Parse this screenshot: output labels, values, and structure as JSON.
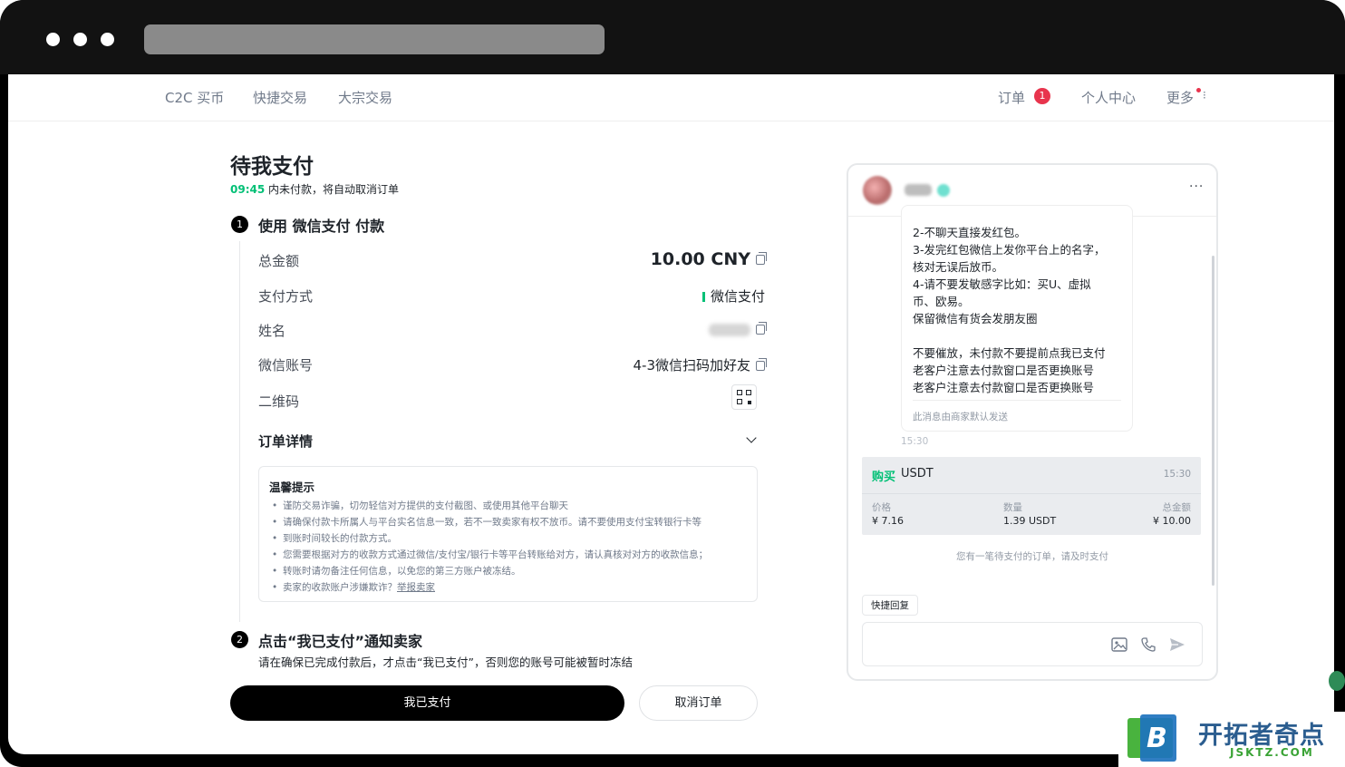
{
  "browser": {
    "dots": 3
  },
  "nav": {
    "left": [
      "C2C 买币",
      "快捷交易",
      "大宗交易"
    ],
    "orders_label": "订单",
    "orders_badge": "1",
    "profile_label": "个人中心",
    "more_label": "更多"
  },
  "main": {
    "title": "待我支付",
    "timer": "09:45",
    "timer_suffix": " 内未付款，将自动取消订单",
    "step1": {
      "num": "1",
      "title": "使用 微信支付 付款"
    },
    "rows": {
      "amount_label": "总金额",
      "amount_value": "10.00 CNY",
      "method_label": "支付方式",
      "method_value": "微信支付",
      "name_label": "姓名",
      "account_label": "微信账号",
      "account_value": "4-3微信扫码加好友",
      "qr_label": "二维码"
    },
    "details_label": "订单详情",
    "tips": {
      "title": "温馨提示",
      "items": [
        "谨防交易诈骗，切勿轻信对方提供的支付截图、或使用其他平台聊天",
        "请确保付款卡所属人与平台实名信息一致，若不一致卖家有权不放币。请不要使用支付宝转银行卡等",
        "到账时间较长的付款方式。",
        "您需要根据对方的收款方式通过微信/支付宝/银行卡等平台转账给对方，请认真核对对方的收款信息；",
        "转账时请勿备注任何信息，以免您的第三方账户被冻结。"
      ],
      "last_prefix": "卖家的收款账户涉嫌欺诈？",
      "report_link": "举报卖家"
    },
    "step2": {
      "num": "2",
      "title": "点击“我已支付”通知卖家"
    },
    "step2_note": "请在确保已完成付款后，才点击“我已支付”，否则您的账号可能被暂时冻结",
    "paid_button": "我已支付",
    "cancel_button": "取消订单"
  },
  "chat": {
    "more": "···",
    "message_lines": [
      "2-不聊天直接发红包。",
      "3-发完红包微信上发你平台上的名字，",
      "核对无误后放币。",
      "4-请不要发敏感字比如：买U、虚拟",
      "币、欧易。",
      "保留微信有货会发朋友圈",
      "",
      "不要催放，未付款不要提前点我已支付",
      "老客户注意去付款窗口是否更换账号",
      "老客户注意去付款窗口是否更换账号"
    ],
    "message_footer": "此消息由商家默认发送",
    "message_time": "15:30",
    "order": {
      "side": "购买",
      "asset": "USDT",
      "time": "15:30",
      "price_label": "价格",
      "price_value": "¥ 7.16",
      "qty_label": "数量",
      "qty_value": "1.39 USDT",
      "total_label": "总金额",
      "total_value": "¥ 10.00"
    },
    "pending_note": "您有一笔待支付的订单，请及时支付",
    "quick_reply": "快捷回复"
  },
  "watermark": {
    "title": "开拓者奇点",
    "sub": "JSKTZ.COM",
    "logo_letter": "B"
  },
  "colors": {
    "accent_green": "#02c076",
    "badge_red": "#e8344d",
    "primary_black": "#000000"
  }
}
